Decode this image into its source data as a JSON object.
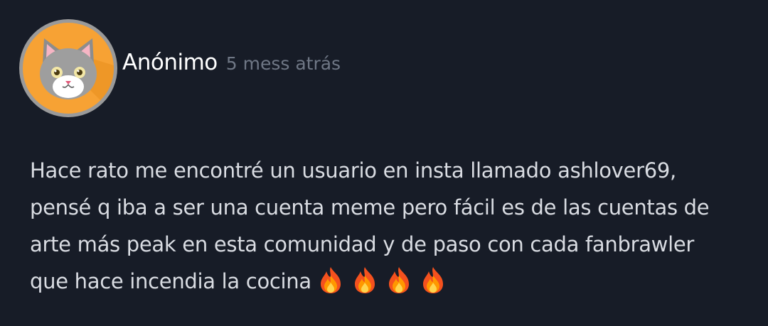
{
  "comment": {
    "author": "Anónimo",
    "timestamp": "5 mess atrás",
    "avatar_icon": "cat-face-icon",
    "avatar_bg": "#f7a234",
    "text_lines": [
      "Hace rato me encontré un usuario en insta llamado ashlover69,",
      "pensé q iba a ser una cuenta meme pero fácil es de las cuentas de",
      "arte más peak en esta comunidad y de paso con cada fanbrawler",
      "que hace incendia la cocina"
    ],
    "emoji_icon": "fire-emoji",
    "emoji_count": 4
  },
  "colors": {
    "background": "#171c27",
    "author": "#ffffff",
    "timestamp": "#6f7785",
    "body": "#d9dce2"
  }
}
